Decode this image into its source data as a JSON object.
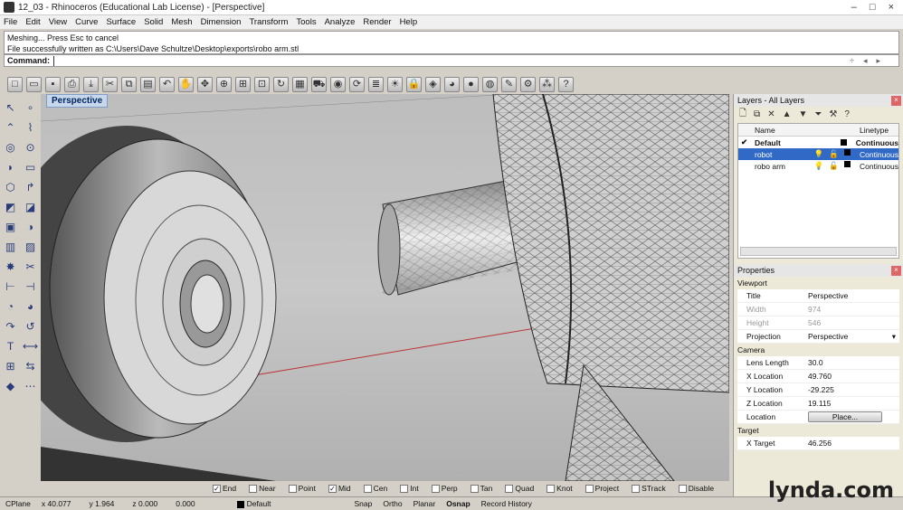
{
  "window": {
    "title": "12_03 - Rhinoceros (Educational Lab License) - [Perspective]",
    "controls": [
      "–",
      "□",
      "×"
    ]
  },
  "menu": [
    "File",
    "Edit",
    "View",
    "Curve",
    "Surface",
    "Solid",
    "Mesh",
    "Dimension",
    "Transform",
    "Tools",
    "Analyze",
    "Render",
    "Help"
  ],
  "command_history": [
    "Meshing... Press Esc to cancel",
    "File successfully written as C:\\Users\\Dave Schultze\\Desktop\\exports\\robo arm.stl"
  ],
  "command": {
    "label": "Command:",
    "value": ""
  },
  "toolbar_icons": [
    "new-icon",
    "open-icon",
    "save-icon",
    "print-icon",
    "import-icon",
    "cut-icon",
    "copy-icon",
    "paste-icon",
    "undo-icon",
    "pan-icon",
    "move-icon",
    "zoom-icon",
    "zoom-extents-icon",
    "zoom-window-icon",
    "rotate-icon",
    "grid-icon",
    "car-icon",
    "camera-icon",
    "circle-arrow-icon",
    "layers-icon",
    "light-icon",
    "lock-icon",
    "render-icon",
    "color-wheel-icon",
    "sphere-icon",
    "globe-icon",
    "pencil-icon",
    "gear-icon",
    "options-icon",
    "help-icon"
  ],
  "viewport": {
    "label": "Perspective"
  },
  "osnap": [
    {
      "label": "End",
      "checked": true
    },
    {
      "label": "Near",
      "checked": false
    },
    {
      "label": "Point",
      "checked": false
    },
    {
      "label": "Mid",
      "checked": true
    },
    {
      "label": "Cen",
      "checked": false
    },
    {
      "label": "Int",
      "checked": false
    },
    {
      "label": "Perp",
      "checked": false
    },
    {
      "label": "Tan",
      "checked": false
    },
    {
      "label": "Quad",
      "checked": false
    },
    {
      "label": "Knot",
      "checked": false
    },
    {
      "label": "Project",
      "checked": false
    },
    {
      "label": "STrack",
      "checked": false
    },
    {
      "label": "Disable",
      "checked": false
    }
  ],
  "status": {
    "cplane": "CPlane",
    "x": "x 40.077",
    "y": "y 1.964",
    "z": "z 0.000",
    "dist": "0.000",
    "layer": "Default",
    "snap": "Snap",
    "ortho": "Ortho",
    "planar": "Planar",
    "osnap": "Osnap",
    "record_history": "Record History"
  },
  "layers_panel": {
    "title": "Layers - All Layers",
    "col_name": "Name",
    "col_linetype": "Linetype",
    "rows": [
      {
        "name": "Default",
        "linetype": "Continuous",
        "current": true,
        "selected": false
      },
      {
        "name": "robot",
        "linetype": "Continuous",
        "current": false,
        "selected": true
      },
      {
        "name": "robo arm",
        "linetype": "Continuous",
        "current": false,
        "selected": false
      }
    ]
  },
  "properties_panel": {
    "title": "Properties",
    "viewport_section": "Viewport",
    "title_label": "Title",
    "title_value": "Perspective",
    "width_label": "Width",
    "width_value": "974",
    "height_label": "Height",
    "height_value": "546",
    "projection_label": "Projection",
    "projection_value": "Perspective",
    "camera_section": "Camera",
    "lens_label": "Lens Length",
    "lens_value": "30.0",
    "xloc_label": "X Location",
    "xloc_value": "49.760",
    "yloc_label": "Y Location",
    "yloc_value": "-29.225",
    "zloc_label": "Z Location",
    "zloc_value": "19.115",
    "location_label": "Location",
    "place_button": "Place...",
    "target_section": "Target",
    "xtarget_label": "X Target",
    "xtarget_value": "46.256"
  },
  "brand": "lynda.com"
}
